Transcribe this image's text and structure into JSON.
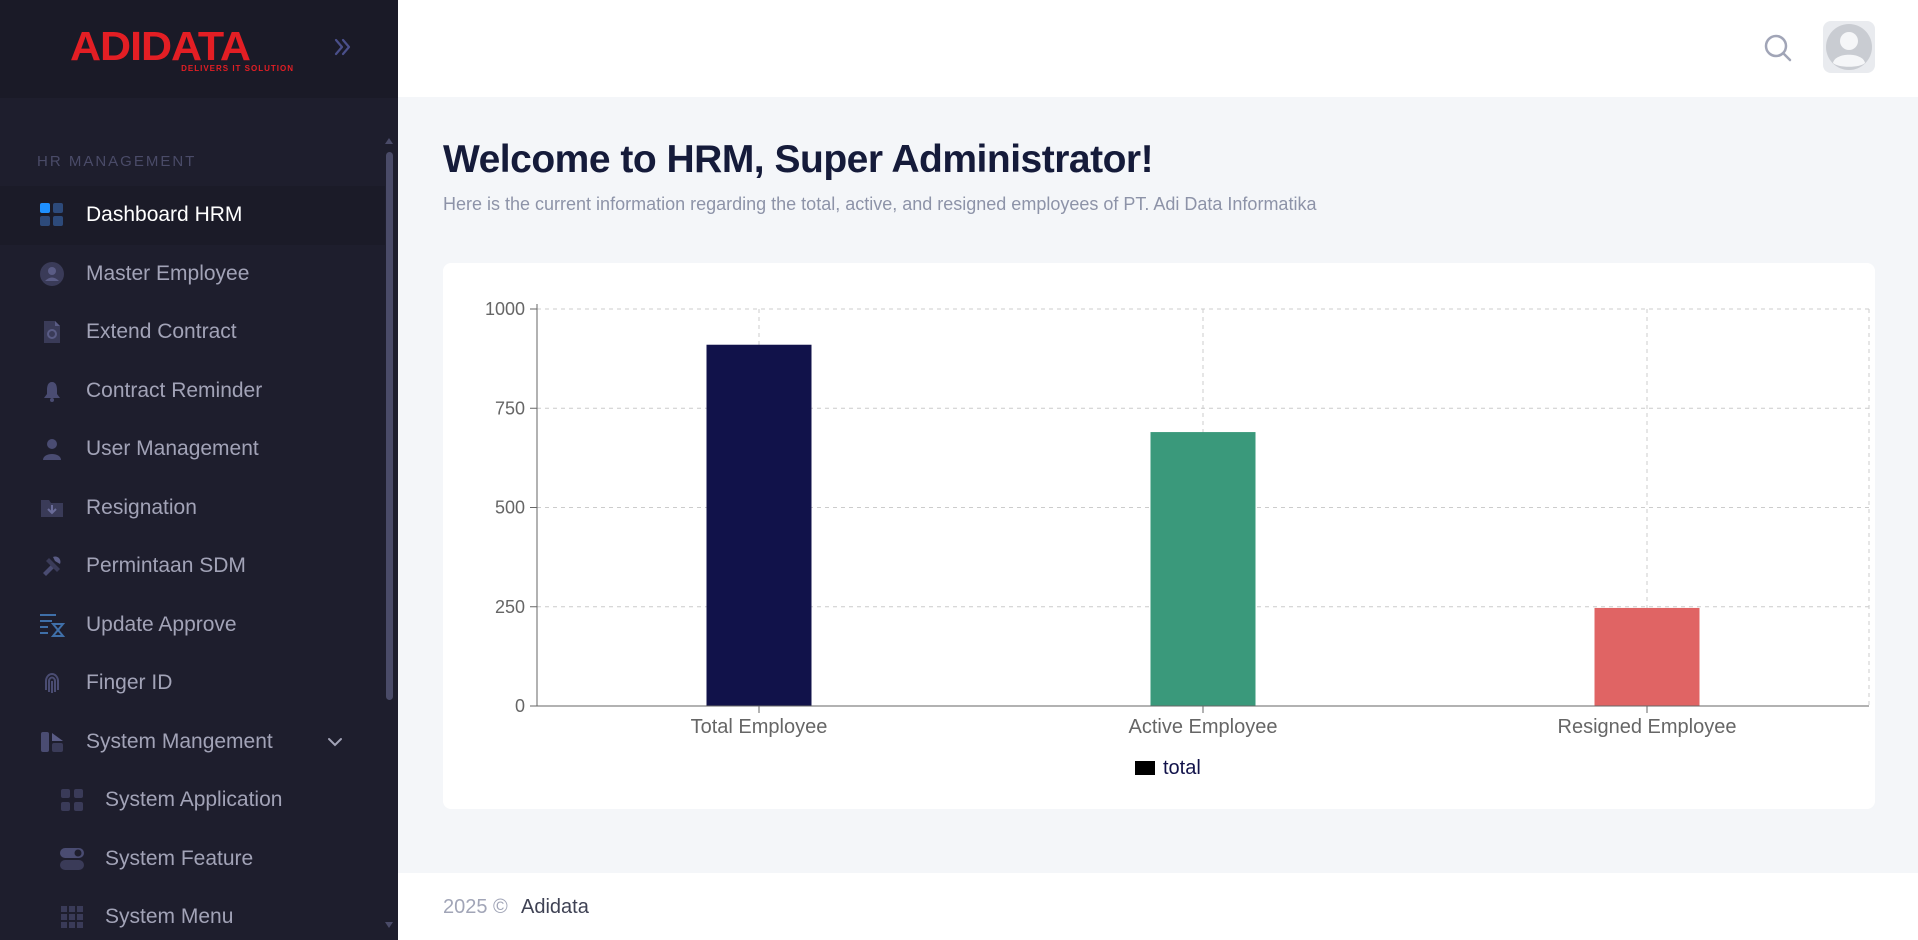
{
  "brand": {
    "logo_text": "ADIDATA",
    "tagline": "DELIVERS IT SOLUTION",
    "logo_color": "#e31e24"
  },
  "sidebar": {
    "section_title": "HR MANAGEMENT",
    "items": [
      {
        "label": "Dashboard HRM",
        "icon": "dashboard-icon",
        "active": true
      },
      {
        "label": "Master Employee",
        "icon": "employee-icon"
      },
      {
        "label": "Extend Contract",
        "icon": "document-icon"
      },
      {
        "label": "Contract Reminder",
        "icon": "bell-icon"
      },
      {
        "label": "User Management",
        "icon": "user-icon"
      },
      {
        "label": "Resignation",
        "icon": "folder-download-icon"
      },
      {
        "label": "Permintaan SDM",
        "icon": "tools-icon"
      },
      {
        "label": "Update Approve",
        "icon": "list-hourglass-icon"
      },
      {
        "label": "Finger ID",
        "icon": "fingerprint-icon"
      },
      {
        "label": "System Mangement",
        "icon": "system-icon",
        "expanded": true
      },
      {
        "label": "System Application",
        "icon": "apps-icon",
        "sub": true
      },
      {
        "label": "System Feature",
        "icon": "toggle-icon",
        "sub": true
      },
      {
        "label": "System Menu",
        "icon": "grid-icon",
        "sub": true
      }
    ]
  },
  "header": {
    "search_icon": "search-icon",
    "avatar_icon": "user-avatar-icon"
  },
  "main": {
    "title": "Welcome to HRM, Super Administrator!",
    "subtitle": "Here is the current information regarding the total, active, and resigned employees of PT. Adi Data Informatika"
  },
  "chart_data": {
    "type": "bar",
    "categories": [
      "Total Employee",
      "Active Employee",
      "Resigned Employee"
    ],
    "series": [
      {
        "name": "total",
        "values": [
          910,
          690,
          247
        ]
      }
    ],
    "bar_colors": [
      "#11124a",
      "#3a997b",
      "#e06464"
    ],
    "legend_color": "#000000",
    "ylim": [
      0,
      1000
    ],
    "yticks": [
      0,
      250,
      500,
      750,
      1000
    ],
    "grid": true,
    "legend_position": "bottom-center"
  },
  "footer": {
    "year": "2025 ©",
    "company": "Adidata"
  }
}
